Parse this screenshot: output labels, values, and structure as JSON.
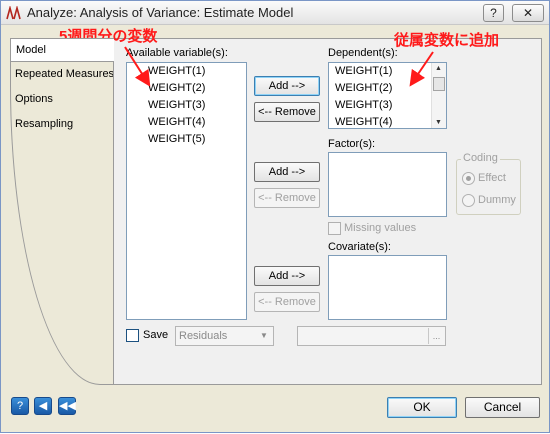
{
  "window": {
    "title": "Analyze: Analysis of Variance: Estimate Model",
    "help_glyph": "?",
    "close_glyph": "✕"
  },
  "tabs": [
    "Model",
    "Repeated Measures",
    "Options",
    "Resampling"
  ],
  "available": {
    "label": "Available variable(s):",
    "items": [
      "WEIGHT(1)",
      "WEIGHT(2)",
      "WEIGHT(3)",
      "WEIGHT(4)",
      "WEIGHT(5)"
    ]
  },
  "dependent": {
    "label": "Dependent(s):",
    "items": [
      "WEIGHT(1)",
      "WEIGHT(2)",
      "WEIGHT(3)",
      "WEIGHT(4)"
    ]
  },
  "factor": {
    "label": "Factor(s):"
  },
  "covariate": {
    "label": "Covariate(s):"
  },
  "buttons": {
    "add": "Add -->",
    "remove": "<-- Remove"
  },
  "missing_values": "Missing values",
  "coding": {
    "label": "Coding",
    "options": [
      "Effect",
      "Dummy"
    ],
    "selected": "Effect"
  },
  "save": {
    "label": "Save",
    "select_value": "Residuals",
    "browse_label": "..."
  },
  "footer": {
    "ok": "OK",
    "cancel": "Cancel",
    "help_icon": "help-icon",
    "back_icon": "back-arrow-icon",
    "first_icon": "rewind-icon"
  },
  "annotations": {
    "left": "5週間分の変数",
    "right": "従属変数に追加",
    "color": "#ff1a1a"
  }
}
